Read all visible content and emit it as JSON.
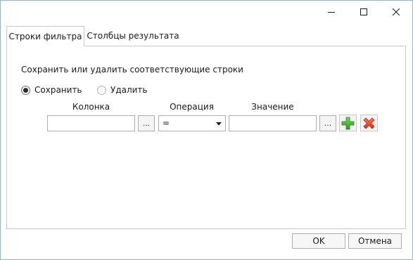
{
  "window": {
    "controls": {
      "minimize_icon": "minimize-icon",
      "maximize_icon": "maximize-icon",
      "close_icon": "close-icon"
    }
  },
  "tabs": [
    {
      "label": "Строки фильтра",
      "active": true
    },
    {
      "label": "Столбцы результата",
      "active": false
    }
  ],
  "filter": {
    "heading": "Сохранить или удалить соответствующие строки",
    "mode_options": [
      {
        "label": "Сохранить",
        "checked": true
      },
      {
        "label": "Удалить",
        "checked": false
      }
    ],
    "columns": {
      "column": "Колонка",
      "operation": "Операция",
      "value": "Значение"
    },
    "row": {
      "column_value": "",
      "browse_label": "...",
      "operation_value": "=",
      "value_value": ""
    },
    "actions": {
      "add_icon": "plus-icon",
      "remove_icon": "x-icon",
      "add_color": "#3aa82c",
      "remove_color": "#e2472a"
    }
  },
  "footer": {
    "ok_label": "OK",
    "cancel_label": "Отмена"
  }
}
